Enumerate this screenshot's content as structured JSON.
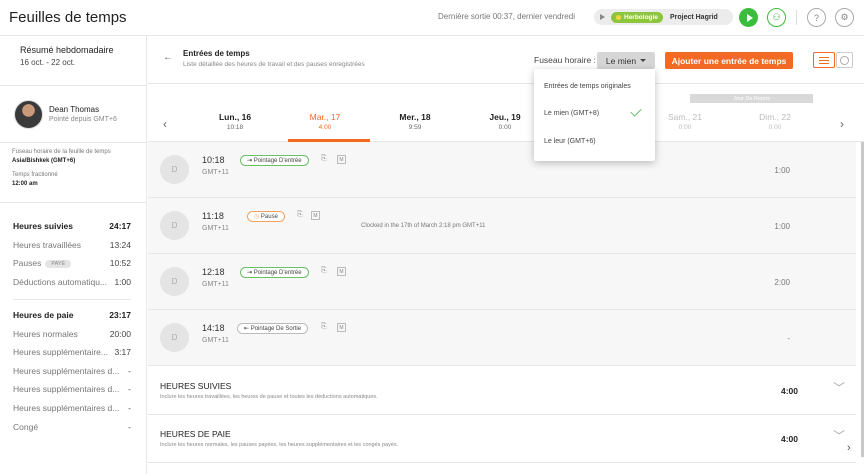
{
  "header": {
    "title": "Feuilles de temps",
    "last_exit": "Dernière sortie 00:37, dernier vendredi",
    "timer": {
      "tag": "Herbologie",
      "project": "Project Hagrid"
    }
  },
  "sidebar": {
    "week_title": "Résumé hebdomadaire",
    "week_range": "16 oct. - 22 oct.",
    "user": {
      "name": "Dean Thomas",
      "subtitle": "Pointé depuis GMT+6"
    },
    "tz_label": "Fuseau horaire de la feuille de temps",
    "tz_value": "Asia/Bishkek (GMT+6)",
    "split_label": "Temps fractionné",
    "split_value": "12:00 am",
    "tracked": [
      {
        "label": "Heures suivies",
        "value": "24:17"
      },
      {
        "label": "Heures travaillées",
        "value": "13:24"
      },
      {
        "label": "Pauses",
        "badge": "PAYÉ",
        "value": "10:52"
      },
      {
        "label": "Déductions automatiqu...",
        "value": "1:00"
      }
    ],
    "pay": [
      {
        "label": "Heures de paie",
        "value": "23:17"
      },
      {
        "label": "Heures normales",
        "value": "20:00"
      },
      {
        "label": "Heures supplémentaire...",
        "value": "3:17"
      },
      {
        "label": "Heures supplémentaires d...",
        "value": "-"
      },
      {
        "label": "Heures supplémentaires d...",
        "value": "-"
      },
      {
        "label": "Heures supplémentaires d...",
        "value": "-"
      },
      {
        "label": "Congé",
        "value": "-"
      }
    ]
  },
  "main": {
    "title": "Entrées de temps",
    "subtitle": "Liste détaillée des heures de travail et des pauses enregistrées",
    "tz_label": "Fuseau horaire :",
    "tz_selected": "Le mien",
    "add_button": "Ajouter une entrée de temps",
    "rest_label": "Jour De Repos",
    "days": [
      {
        "name": "Lun., 16",
        "total": "10:18"
      },
      {
        "name": "Mar., 17",
        "total": "4:00"
      },
      {
        "name": "Mer., 18",
        "total": "9:59"
      },
      {
        "name": "Jeu., 19",
        "total": "0:00"
      },
      {
        "name": "Sam., 21",
        "total": "0:00"
      },
      {
        "name": "Dim., 22",
        "total": "0:00"
      }
    ],
    "entries": [
      {
        "avatar": "D",
        "time": "10:18",
        "gmt": "GMT+11",
        "type": "Pointage D'entrée",
        "note": "",
        "duration": "1:00"
      },
      {
        "avatar": "D",
        "time": "11:18",
        "gmt": "GMT+11",
        "type": "Pause",
        "note": "Clocked in the 17th of March 2:18 pm GMT+11",
        "duration": "1:00"
      },
      {
        "avatar": "D",
        "time": "12:18",
        "gmt": "GMT+11",
        "type": "Pointage D'entrée",
        "note": "",
        "duration": "2:00"
      },
      {
        "avatar": "D",
        "time": "14:18",
        "gmt": "GMT+11",
        "type": "Pointage De Sortie",
        "note": "",
        "duration": "-"
      }
    ],
    "sections": [
      {
        "title": "HEURES SUIVIES",
        "subtitle": "Inclure les heures travaillées, les heures de pause et toutes les déductions automatiques.",
        "value": "4:00"
      },
      {
        "title": "HEURES DE PAIE",
        "subtitle": "Inclure les heures normales, les pauses payées, les heures supplémentaires et les congés payés.",
        "value": "4:00"
      }
    ],
    "m_label": "M"
  },
  "dropdown": {
    "items": [
      "Entrées de temps originales",
      "Le mien (GMT+8)",
      "Le leur (GMT+6)"
    ]
  },
  "colors": {
    "accent": "#f26a23",
    "green": "#3cbc3c"
  }
}
